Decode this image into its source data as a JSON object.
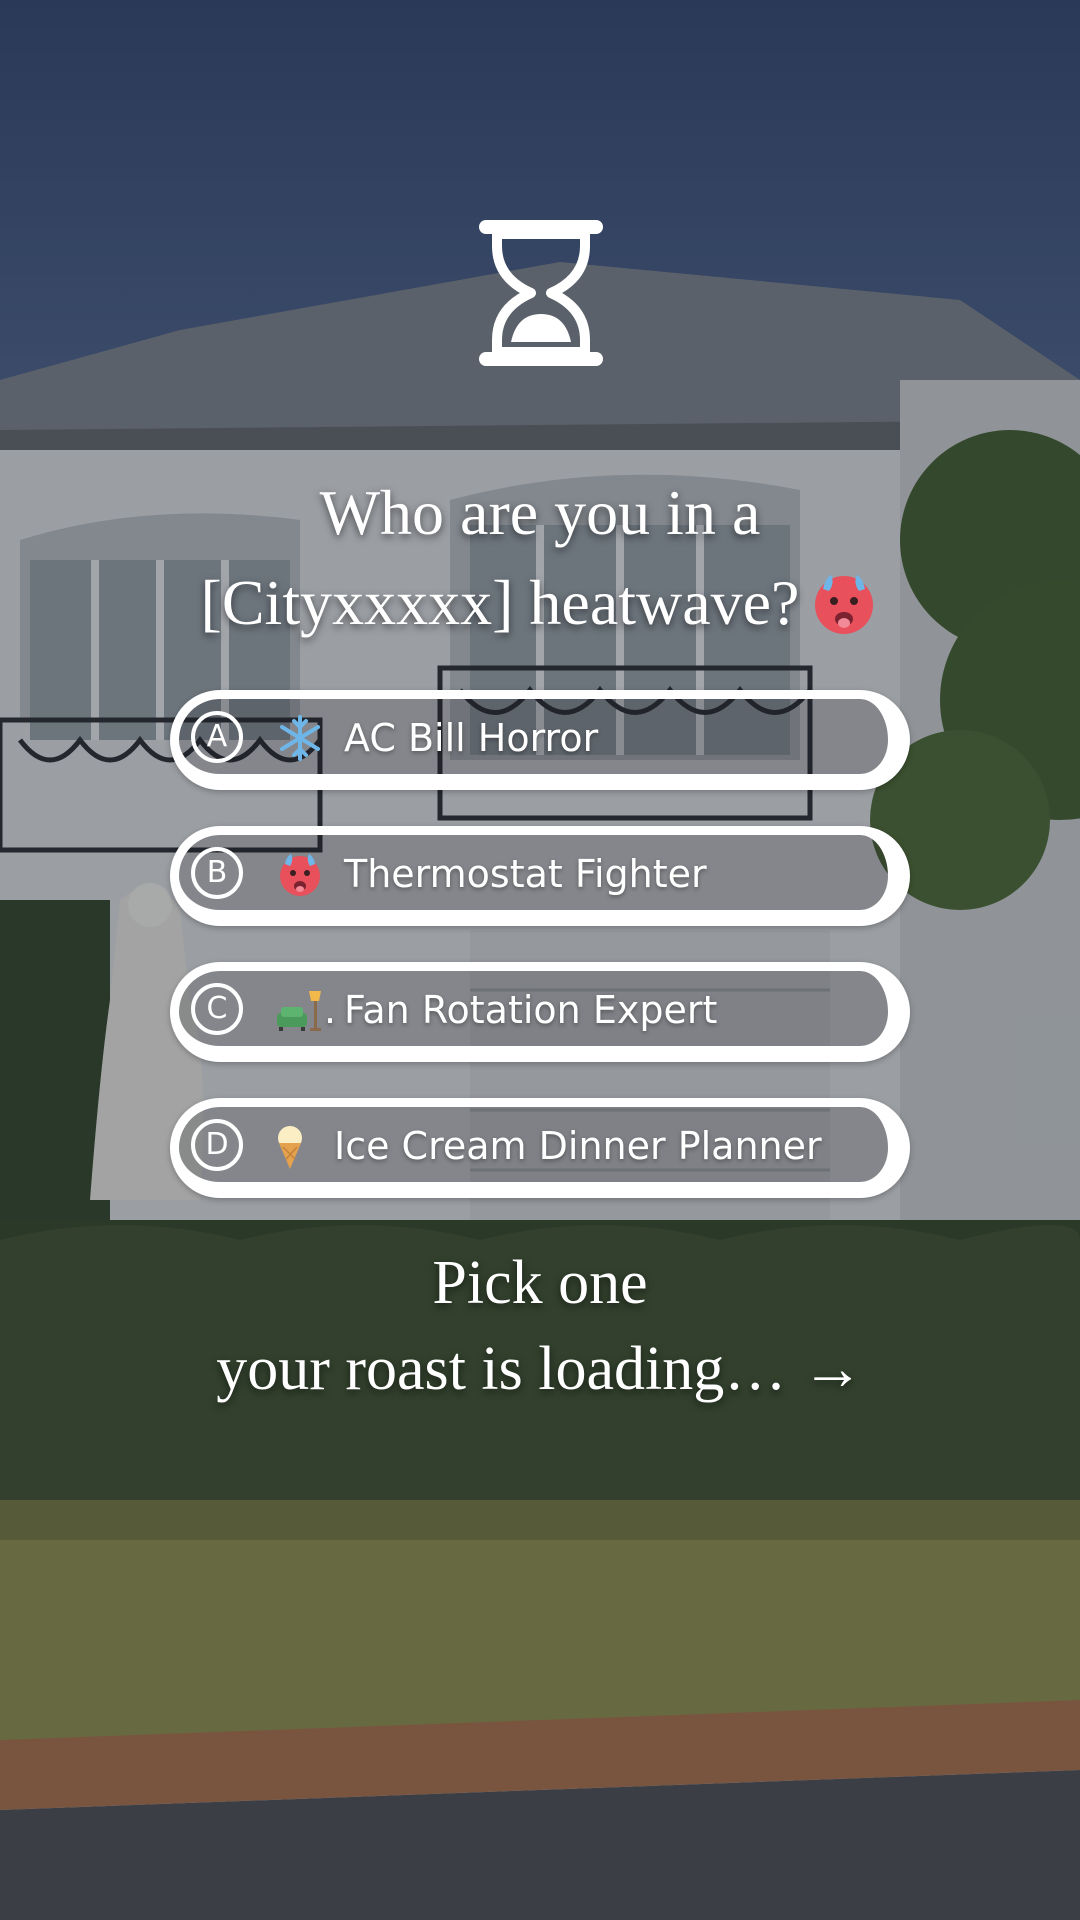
{
  "background": {
    "description_icon": "house-photo-background",
    "sky_color": "#3e5273",
    "house_color": "#d6d8d8",
    "roof_color": "#7b8186",
    "hedge_color": "#3a4a2a",
    "lawn_color": "#8a8c4c",
    "curb_color": "#a0704d",
    "road_color": "#4d4f53"
  },
  "header": {
    "icon": "hourglass-icon"
  },
  "question": {
    "line1": "Who are you in a",
    "line2": "[Cityxxxxx] heatwave?",
    "emoji": "hot-face-icon"
  },
  "options": [
    {
      "letter": "A",
      "emoji": "snowflake-icon",
      "label": "AC Bill Horror"
    },
    {
      "letter": "B",
      "emoji": "hot-face-icon",
      "label": "Thermostat Fighter"
    },
    {
      "letter": "C",
      "emoji": "couch-and-lamp-icon",
      "emoji_suffix": ".",
      "label": "Fan Rotation Expert"
    },
    {
      "letter": "D",
      "emoji": "ice-cream-icon",
      "label": "Ice Cream Dinner Planner"
    }
  ],
  "cta": {
    "line1": "Pick one",
    "line2": "your roast is loading… →"
  },
  "colors": {
    "text": "#ffffff",
    "option_border": "#ffffff",
    "emoji_red": "#e8505b",
    "emoji_blue": "#6fb6e8"
  }
}
